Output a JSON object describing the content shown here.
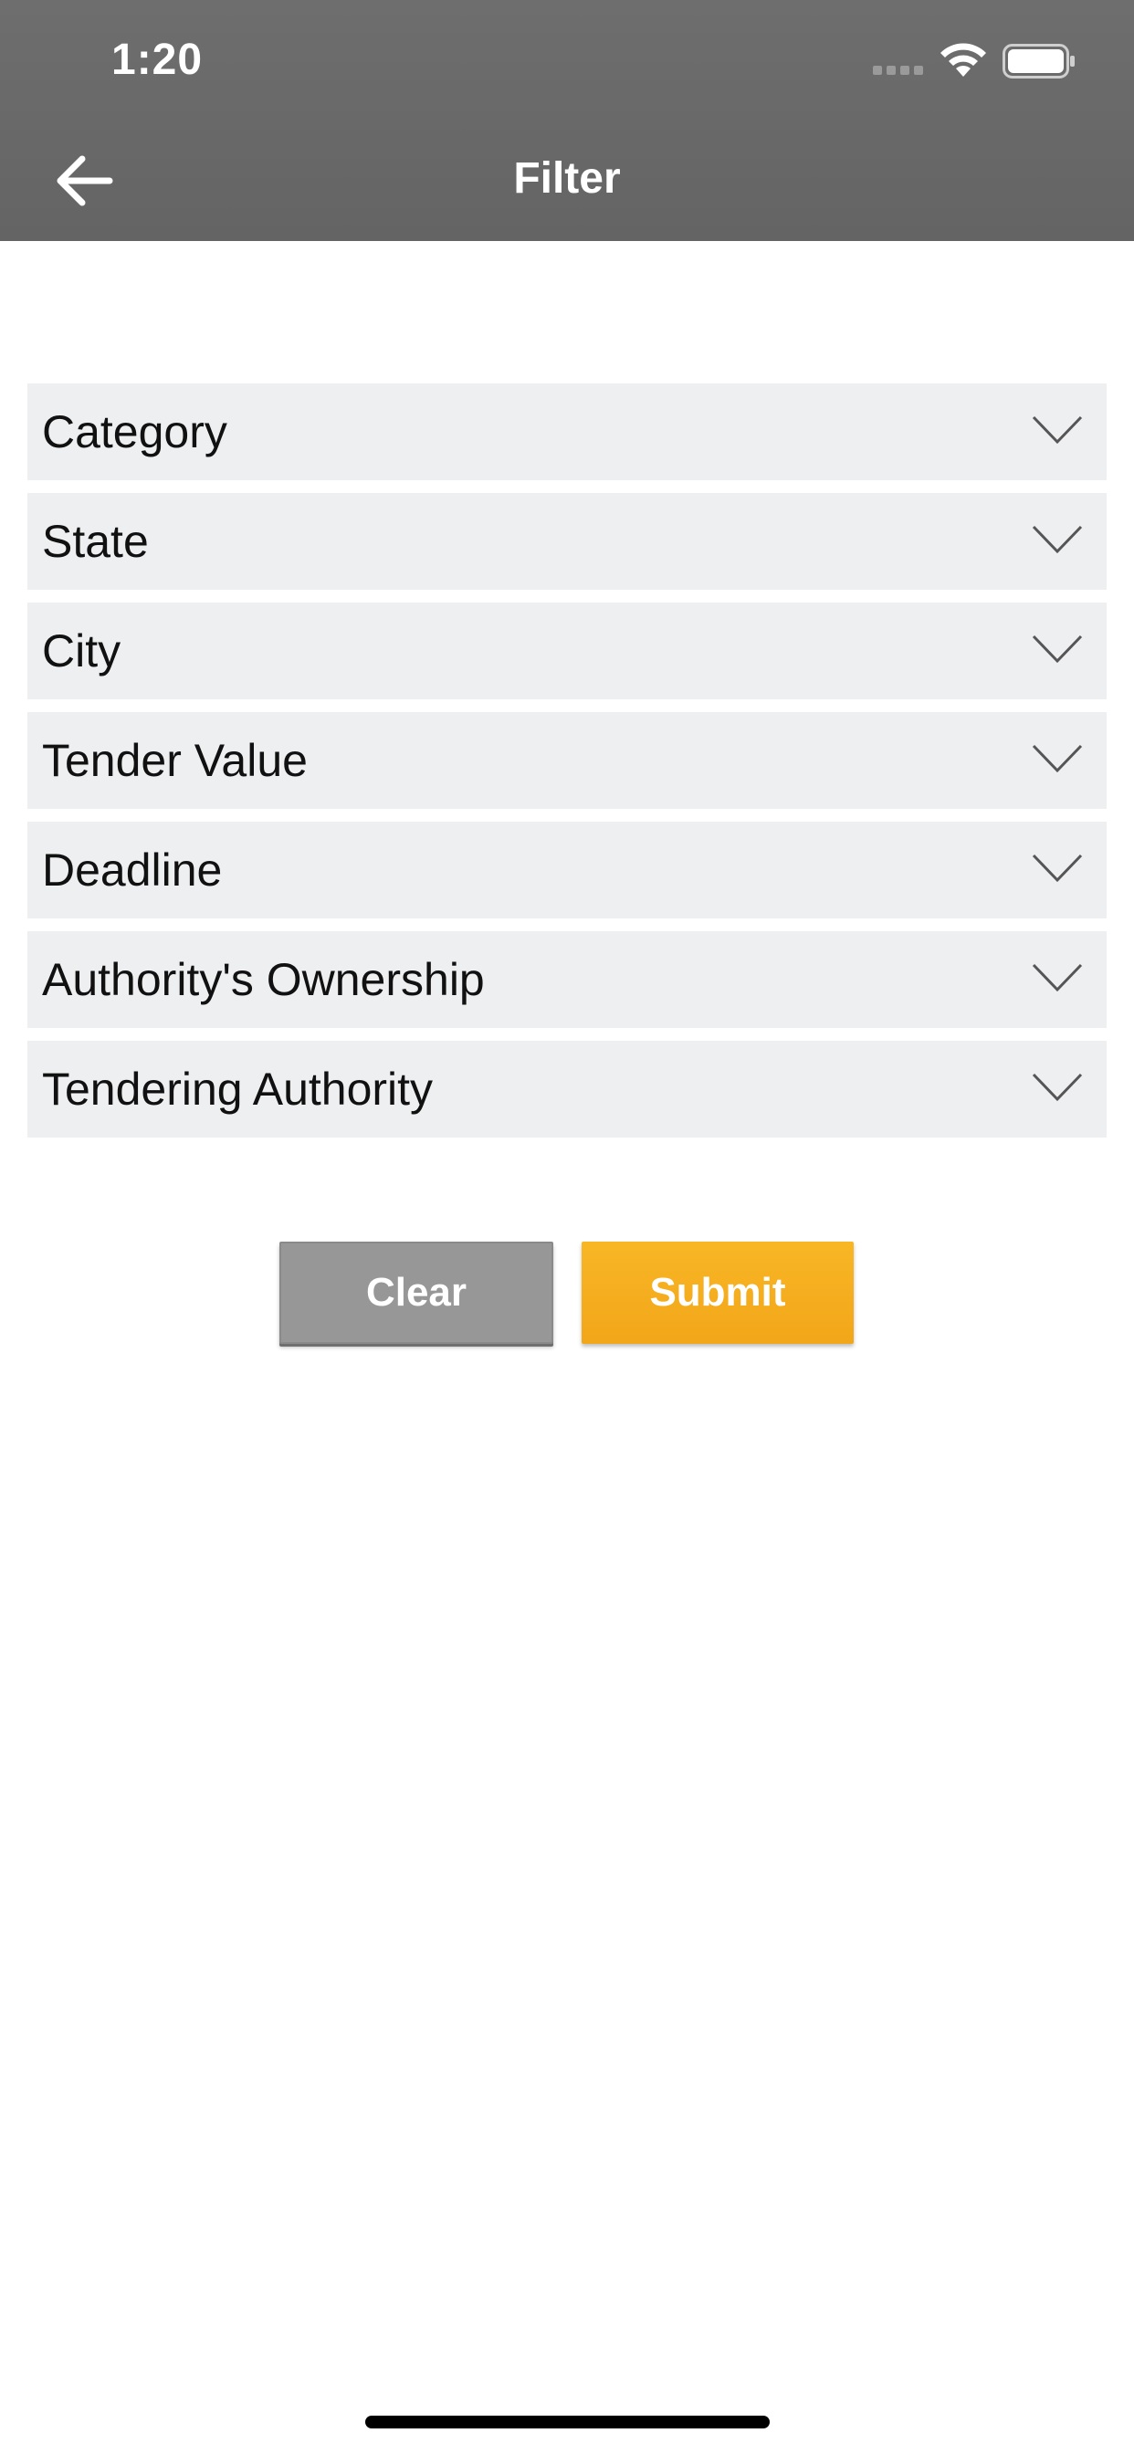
{
  "status_bar": {
    "time": "1:20",
    "icons": [
      "cellular-signal-icon",
      "wifi-icon",
      "battery-icon"
    ]
  },
  "header": {
    "title": "Filter",
    "back_icon": "arrow-left-icon",
    "background_color": "#666666"
  },
  "filters": {
    "items": [
      {
        "label": "Category"
      },
      {
        "label": "State"
      },
      {
        "label": "City"
      },
      {
        "label": "Tender Value"
      },
      {
        "label": "Deadline"
      },
      {
        "label": "Authority's Ownership"
      },
      {
        "label": "Tendering Authority"
      }
    ],
    "expand_icon": "chevron-down-icon",
    "item_background": "#eeeff1"
  },
  "actions": {
    "clear_label": "Clear",
    "submit_label": "Submit",
    "clear_color": "#979797",
    "submit_color": "#f4ac1e"
  }
}
